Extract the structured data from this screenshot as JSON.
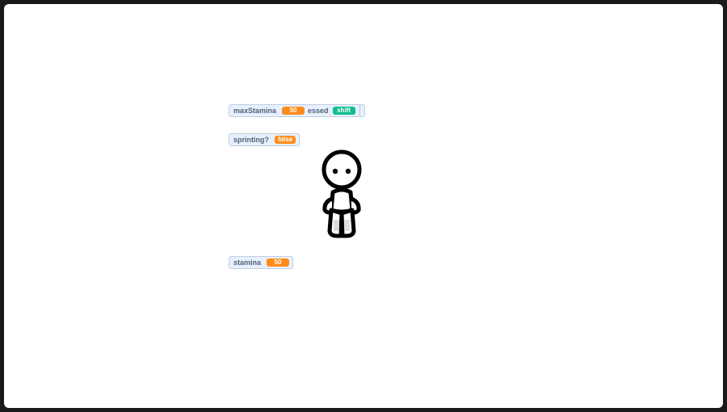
{
  "monitors": {
    "max_stamina": {
      "label": "maxStamina",
      "value": "50"
    },
    "key_pressed": {
      "label": "essed",
      "value": "shift"
    },
    "sprinting": {
      "label": "sprinting?",
      "value": "false"
    },
    "stamina": {
      "label": "stamina",
      "value": "50"
    }
  },
  "colors": {
    "stage_background": "#ffffff",
    "frame": "#1a1a1a",
    "monitor_background": "#e6f0ff",
    "monitor_border": "#c4cddb",
    "variable_value": "#ff8c1a",
    "sensing_value": "#0fbd8c"
  },
  "sprite": {
    "name_icon": "stick-figure-character-sprite"
  }
}
